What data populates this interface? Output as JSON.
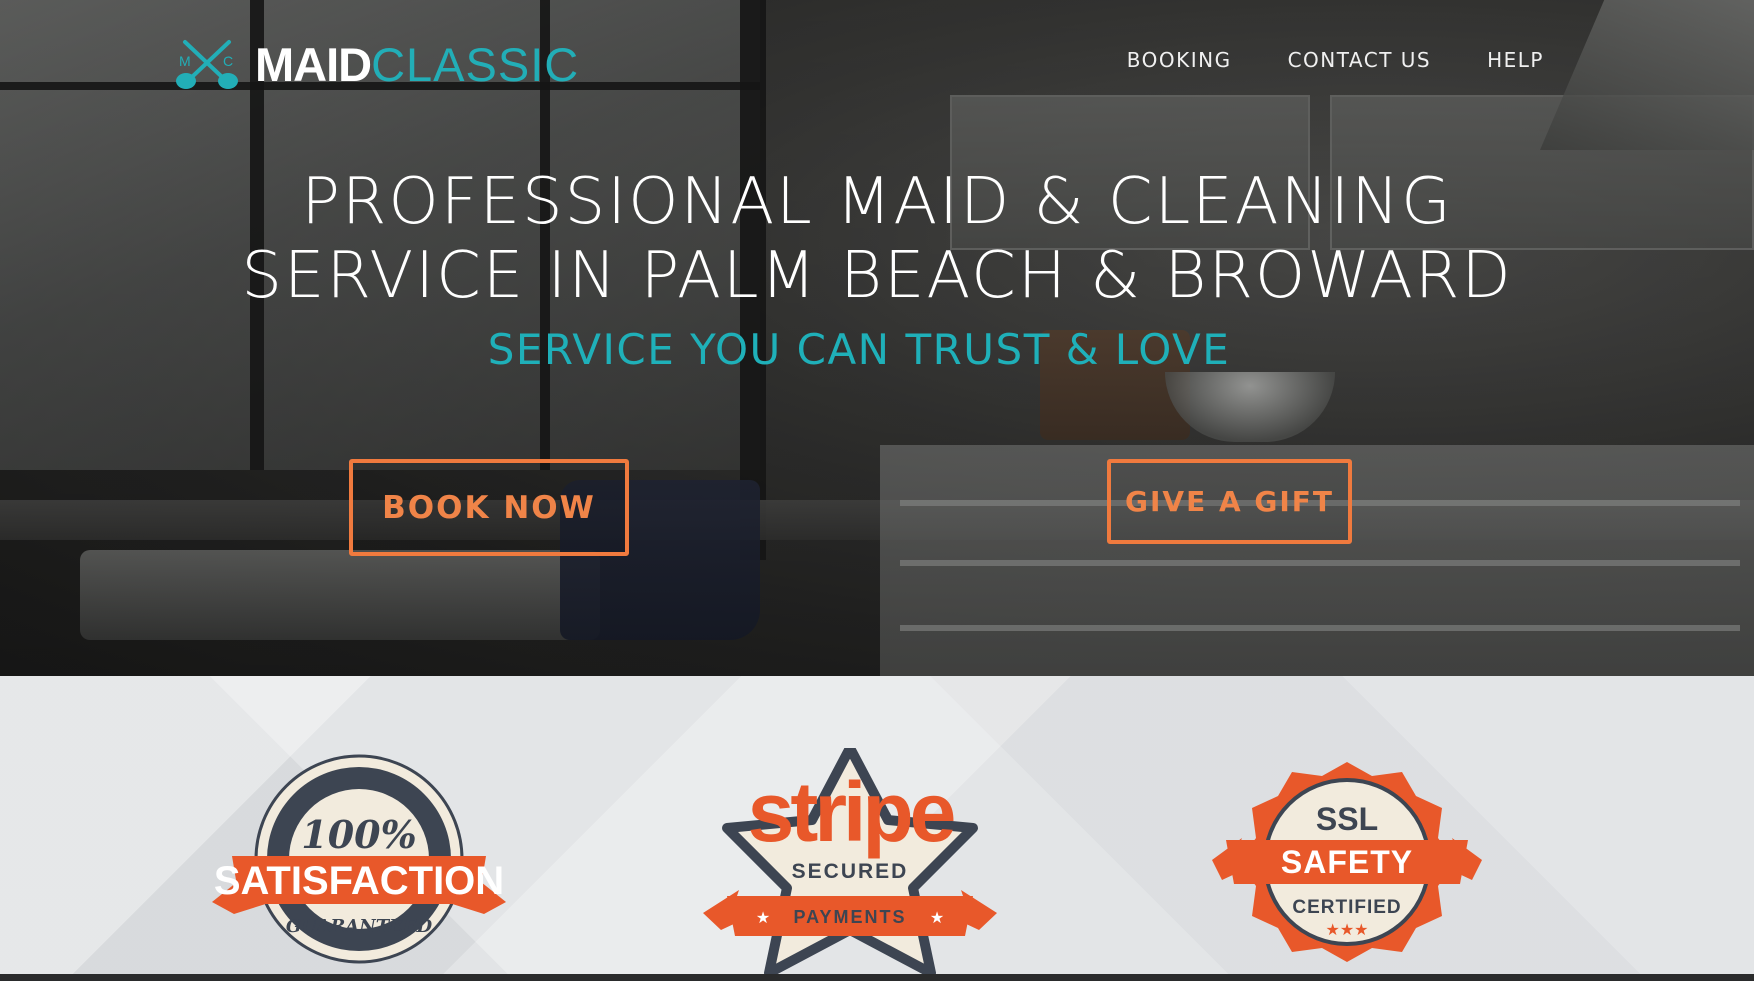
{
  "brand": {
    "icon_letters": [
      "M",
      "C"
    ],
    "name_bold": "MAID",
    "name_light": "CLASSIC",
    "accent_color": "#22aeb7"
  },
  "nav": {
    "items": [
      {
        "label": "BOOKING"
      },
      {
        "label": "CONTACT US"
      },
      {
        "label": "HELP"
      }
    ]
  },
  "hero": {
    "headline_line1": "PROFESSIONAL MAID & CLEANING",
    "headline_line2": "SERVICE IN PALM BEACH & BROWARD",
    "tagline": "SERVICE YOU CAN TRUST & LOVE",
    "book_button": "BOOK NOW",
    "gift_button": "GIVE A GIFT",
    "button_color": "#f07a3e"
  },
  "badges": {
    "satisfaction": {
      "percent": "100%",
      "main": "SATISFACTION",
      "sub": "GUARANTEED"
    },
    "stripe": {
      "brand": "stripe",
      "line1": "SECURED",
      "line2": "PAYMENTS"
    },
    "ssl": {
      "top": "SSL",
      "main": "SAFETY",
      "sub": "CERTIFIED",
      "stars": "★★★"
    },
    "badge_color": "#e8582a"
  }
}
